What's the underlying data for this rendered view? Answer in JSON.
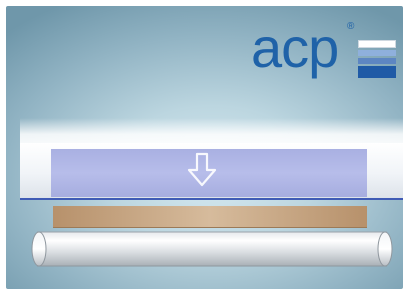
{
  "logo": {
    "text": "acp",
    "registered_mark": "®",
    "brand_color": "#1f62a8",
    "mark_colors": [
      "#ffffff",
      "#8fb0dc",
      "#5d86c2",
      "#1f5aa6"
    ]
  },
  "diagram": {
    "plate_color": "#b0b6e6",
    "veneer_color": "#d6bb9c",
    "accent_line_color": "#3f5bb5",
    "arrow_icon": "arrow-down-icon"
  }
}
